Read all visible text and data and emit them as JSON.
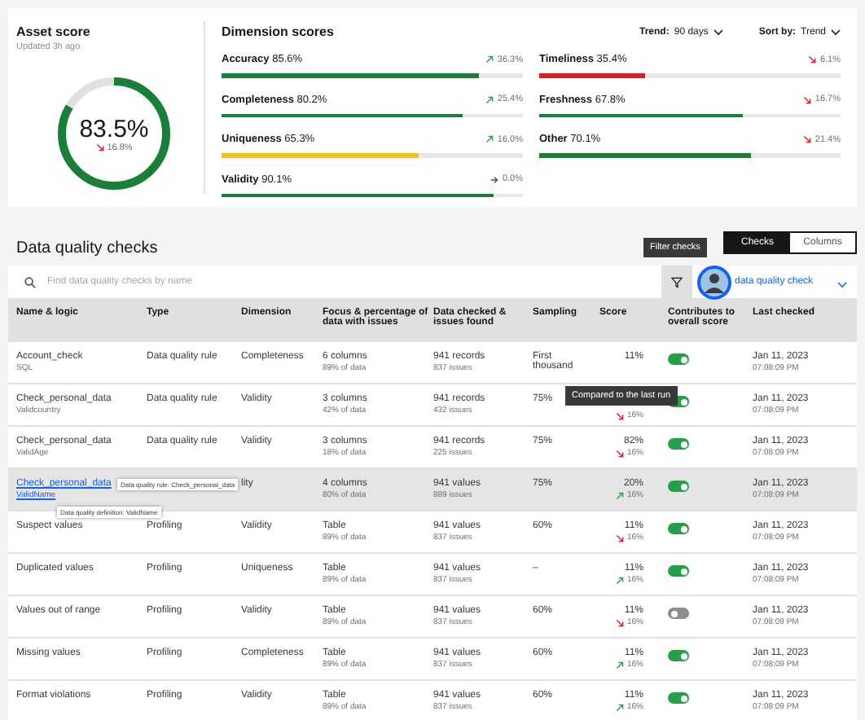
{
  "asset_score": {
    "title": "Asset score",
    "updated": "Updated 3h ago",
    "value": "83.5%",
    "change": {
      "kind": "down",
      "text": "16.8%"
    }
  },
  "dimension_scores": {
    "title": "Dimension scores",
    "trend_label": "Trend:",
    "trend_value": "90 days",
    "sort_label": "Sort by:",
    "sort_value": "Trend",
    "columns": [
      {
        "items": [
          {
            "name": "Accuracy",
            "value": "85.6%",
            "level": 0.856,
            "color": "#198038",
            "change": {
              "kind": "up",
              "text": "36.3%"
            }
          },
          {
            "name": "Completeness",
            "value": "80.2%",
            "level": 0.802,
            "color": "#198038",
            "change": {
              "kind": "up",
              "text": "25.4%"
            }
          },
          {
            "name": "Uniqueness",
            "value": "65.3%",
            "level": 0.653,
            "color": "#f1c21b",
            "change": {
              "kind": "up",
              "text": "16.0%"
            }
          },
          {
            "name": "Validity",
            "value": "90.1%",
            "level": 0.901,
            "color": "#198038",
            "change": {
              "kind": "flat",
              "text": "0.0%"
            }
          }
        ]
      },
      {
        "items": [
          {
            "name": "Timeliness",
            "value": "35.4%",
            "level": 0.354,
            "color": "#da1e28",
            "change": {
              "kind": "down",
              "text": "6.1%"
            }
          },
          {
            "name": "Freshness",
            "value": "67.8%",
            "level": 0.678,
            "color": "#198038",
            "change": {
              "kind": "down",
              "text": "16.7%"
            }
          },
          {
            "name": "Other",
            "value": "70.1%",
            "level": 0.701,
            "color": "#198038",
            "change": {
              "kind": "down",
              "text": "21.4%"
            }
          }
        ]
      }
    ]
  },
  "checks": {
    "title": "Data quality checks",
    "view_tabs": [
      {
        "label": "Checks",
        "selected": true
      },
      {
        "label": "Columns",
        "selected": false
      }
    ],
    "search": {
      "placeholder": "Find data quality checks by name"
    },
    "filter_tooltip": "Filter checks",
    "filter_value": "data quality check",
    "columns": [
      "Name & logic",
      "Type",
      "Dimension",
      "Focus & percentage of data with issues",
      "Data checked & issues found",
      "Sampling",
      "Score",
      "Contributes to overall score",
      "Last checked"
    ],
    "rows": [
      {
        "name": "Account_check",
        "logic": "SQL",
        "link": false,
        "selected": false,
        "type": "Data quality rule",
        "dimension": "Completeness",
        "focus": "6 columns",
        "focus_share": "89% of data",
        "data_checked": "941 records",
        "issues": "837 issues",
        "sampling": "First thousand",
        "score": "11%",
        "contributes": true,
        "date": "Jan 11, 2023",
        "time": "07:08:09 PM"
      },
      {
        "name": "Check_personal_data",
        "logic": "Validcountry",
        "link": false,
        "selected": false,
        "type": "Data quality rule",
        "dimension": "Validity",
        "focus": "3 columns",
        "focus_share": "42% of data",
        "data_checked": "941 records",
        "issues": "432 issues",
        "sampling": "75%",
        "change": {
          "kind": "down",
          "text": "16%"
        },
        "score_tooltip": "Compared to the last run",
        "contributes": true,
        "date": "Jan 11, 2023",
        "time": "07:08:09 PM"
      },
      {
        "name": "Check_personal_data",
        "logic": "ValidAge",
        "link": false,
        "selected": false,
        "type": "Data quality rule",
        "dimension": "Validity",
        "focus": "3 columns",
        "focus_share": "18% of data",
        "data_checked": "941 records",
        "issues": "225 issues",
        "sampling": "75%",
        "score": "82%",
        "change": {
          "kind": "down",
          "text": "16%"
        },
        "contributes": true,
        "date": "Jan 11, 2023",
        "time": "07:08:09 PM"
      },
      {
        "name": "Check_personal_data",
        "logic": "ValidName",
        "link": true,
        "selected": true,
        "name_tooltip": "Data quality rule: Check_personal_data",
        "logic_tooltip": "Data quality definition: ValidName",
        "dimension": "lity",
        "focus": "4 columns",
        "focus_share": "80% of data",
        "data_checked": "941 values",
        "issues": "889 issues",
        "sampling": "75%",
        "score": "20%",
        "change": {
          "kind": "up",
          "text": "16%"
        },
        "contributes": true,
        "date": "Jan 11, 2023",
        "time": "07:08:09 PM"
      },
      {
        "name": "Suspect values",
        "link": false,
        "selected": false,
        "type": "Profiling",
        "dimension": "Validity",
        "focus": "Table",
        "focus_share": "89% of data",
        "data_checked": "941 values",
        "issues": "837 issues",
        "sampling": "60%",
        "score": "11%",
        "change": {
          "kind": "down",
          "text": "16%"
        },
        "contributes": true,
        "date": "Jan 11, 2023",
        "time": "07:08:09 PM"
      },
      {
        "name": "Duplicated values",
        "link": false,
        "selected": false,
        "type": "Profiling",
        "dimension": "Uniqueness",
        "focus": "Table",
        "focus_share": "89% of data",
        "data_checked": "941 values",
        "issues": "837 issues",
        "sampling": "–",
        "score": "11%",
        "change": {
          "kind": "up",
          "text": "16%"
        },
        "contributes": true,
        "date": "Jan 11, 2023",
        "time": "07:08:09 PM"
      },
      {
        "name": "Values out of range",
        "link": false,
        "selected": false,
        "type": "Profiling",
        "dimension": "Validity",
        "focus": "Table",
        "focus_share": "89% of data",
        "data_checked": "941 values",
        "issues": "837 issues",
        "sampling": "60%",
        "score": "11%",
        "change": {
          "kind": "down",
          "text": "16%"
        },
        "contributes": false,
        "date": "Jan 11, 2023",
        "time": "07:08:09 PM"
      },
      {
        "name": "Missing values",
        "link": false,
        "selected": false,
        "type": "Profiling",
        "dimension": "Completeness",
        "focus": "Table",
        "focus_share": "89% of data",
        "data_checked": "941 values",
        "issues": "837 issues",
        "sampling": "60%",
        "score": "11%",
        "change": {
          "kind": "up",
          "text": "16%"
        },
        "contributes": true,
        "date": "Jan 11, 2023",
        "time": "07:08:09 PM"
      },
      {
        "name": "Format violations",
        "link": false,
        "selected": false,
        "type": "Profiling",
        "dimension": "Validity",
        "focus": "Table",
        "focus_share": "89% of data",
        "data_checked": "941 values",
        "issues": "837 issues",
        "sampling": "60%",
        "score": "11%",
        "change": {
          "kind": "up",
          "text": "16%"
        },
        "contributes": true,
        "date": "Jan 11, 2023",
        "time": "07:08:09 PM"
      }
    ]
  }
}
